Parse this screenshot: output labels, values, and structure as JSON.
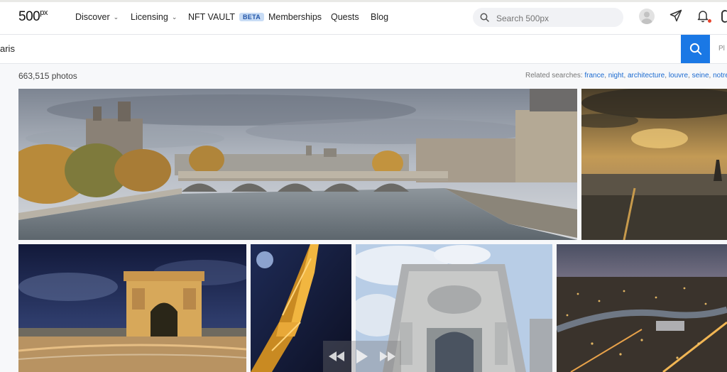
{
  "nav": {
    "logo_main": "500",
    "logo_sup": "px",
    "items": [
      {
        "label": "Discover",
        "has_dropdown": true
      },
      {
        "label": "Licensing",
        "has_dropdown": true
      },
      {
        "label": "NFT VAULT",
        "badge": "BETA"
      },
      {
        "label": "Memberships"
      },
      {
        "label": "Quests"
      },
      {
        "label": "Blog"
      }
    ],
    "search_placeholder": "Search 500px"
  },
  "search": {
    "query": "aris",
    "right_cut": "Pl"
  },
  "results": {
    "count": "663,515 photos",
    "related_label": "Related searches:",
    "related": [
      "france",
      "night",
      "architecture",
      "louvre",
      "seine",
      "notre-c"
    ]
  },
  "photos": [
    {
      "subject": "Seine river bridge panorama"
    },
    {
      "subject": "Paris sunset over skyline"
    },
    {
      "subject": "Arc de Triomphe at night"
    },
    {
      "subject": "Eiffel Tower lit up"
    },
    {
      "subject": "Louvre facade"
    },
    {
      "subject": "Paris city lights at dusk"
    }
  ],
  "colors": {
    "accent": "#1a78e5",
    "link": "#1b6ad0",
    "badge_bg": "#c8dcf5",
    "notification": "#e8442d"
  },
  "icons": [
    "search-icon",
    "send-icon",
    "bell-icon",
    "chevron-down-icon",
    "rewind-icon",
    "play-icon",
    "forward-icon"
  ]
}
